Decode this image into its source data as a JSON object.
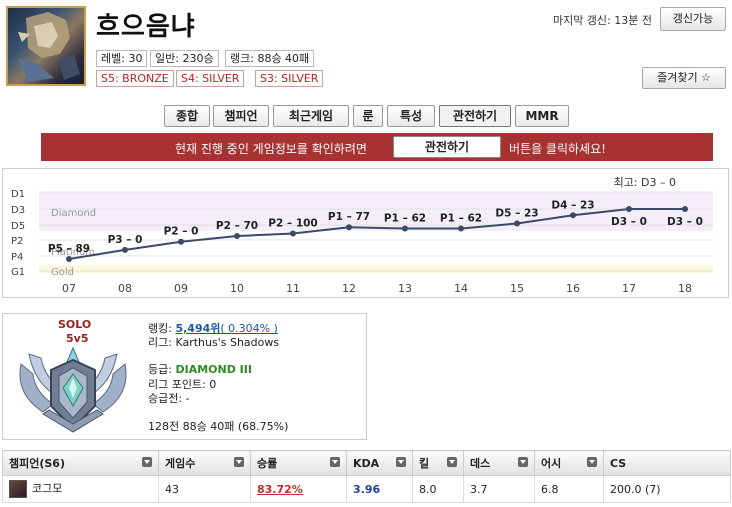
{
  "summoner": {
    "name": "흐으음냐",
    "level_badge": "레벨: 30",
    "normal_badge": "일반: 230승",
    "rank_badge": "랭크: 88승 40패",
    "season_badges": [
      "S5: BRONZE",
      "S4: SILVER",
      "S3: SILVER"
    ]
  },
  "header": {
    "last_update": "마지막 갱신: 13분 전",
    "update_button": "갱신가능",
    "favorite_button": "즐겨찾기 ☆"
  },
  "tabs": [
    {
      "label": "종합",
      "active": false
    },
    {
      "label": "챔피언",
      "active": false
    },
    {
      "label": "최근게임",
      "active": false
    },
    {
      "label": "룬",
      "active": false
    },
    {
      "label": "특성",
      "active": false
    },
    {
      "label": "관전하기",
      "active": true
    },
    {
      "label": "MMR",
      "active": false
    }
  ],
  "banner": {
    "text_before": "현재 진행 중인 게임정보를 확인하려면",
    "button": "관전하기",
    "text_after": "버튼을 클릭하세요!"
  },
  "chart_data": {
    "type": "line",
    "title": "",
    "best_label": "최고: D3 – 0",
    "y_ticks": [
      "D1",
      "D3",
      "D5",
      "P2",
      "P4",
      "G1"
    ],
    "tier_bands": [
      "Diamond",
      "Platinum",
      "Gold"
    ],
    "x": [
      "07",
      "08",
      "09",
      "10",
      "11",
      "12",
      "13",
      "14",
      "15",
      "16",
      "17",
      "18"
    ],
    "points": [
      {
        "x": "07",
        "label": "P5 – 89"
      },
      {
        "x": "08",
        "label": "P3 – 0"
      },
      {
        "x": "09",
        "label": "P2 – 0"
      },
      {
        "x": "10",
        "label": "P2 – 70"
      },
      {
        "x": "11",
        "label": "P2 – 100"
      },
      {
        "x": "12",
        "label": "P1 – 77"
      },
      {
        "x": "13",
        "label": "P1 – 62"
      },
      {
        "x": "14",
        "label": "P1 – 62"
      },
      {
        "x": "15",
        "label": "D5 – 23"
      },
      {
        "x": "16",
        "label": "D4 – 23"
      },
      {
        "x": "17",
        "label": "D3 – 0"
      },
      {
        "x": "18",
        "label": "D3 – 0"
      }
    ]
  },
  "rank": {
    "queue": "SOLO",
    "format": "5v5",
    "ranking_label": "랭킹: ",
    "ranking_value": "5,494위",
    "ranking_pct": "( 0.304% )",
    "league": "리그: Karthus's Shadows",
    "tier_label": "등급: ",
    "tier_value": "DIAMOND III",
    "league_points": "리그 포인트: 0",
    "promotion": "승급전: -",
    "record": "128전 88승 40패 (68.75%)"
  },
  "table": {
    "headers": [
      "챔피언(S6)",
      "게임수",
      "승률",
      "KDA",
      "킬",
      "데스",
      "어시",
      "CS"
    ],
    "rows": [
      {
        "champion": "코그모",
        "games": "43",
        "winrate": "83.72%",
        "kda": "3.96",
        "kills": "8.0",
        "deaths": "3.7",
        "assists": "6.8",
        "cs": "200.0 (7)"
      }
    ]
  },
  "colors": {
    "banner": "#a83232",
    "badge_red": "#bb2222",
    "link_blue": "#1a56b0",
    "tier_green": "#2e8b22",
    "winrate_red": "#c03030",
    "kda_blue": "#1d3fa8",
    "diamond_band": "#f4eef8",
    "gold_band": "#fbf8dc"
  }
}
